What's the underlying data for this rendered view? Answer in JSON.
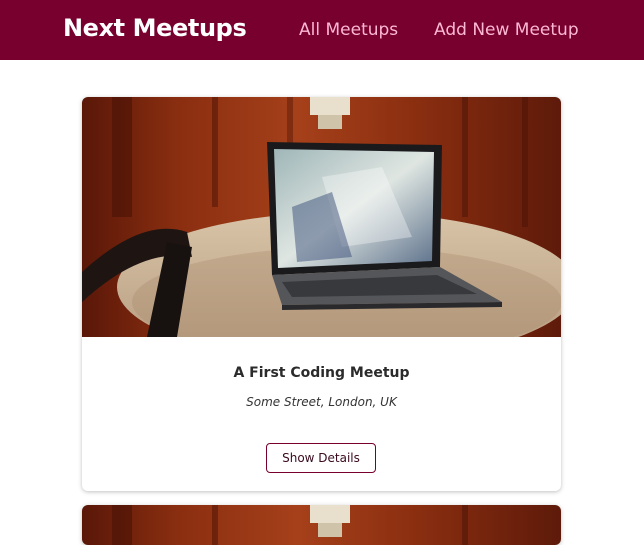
{
  "header": {
    "logo": "Next Meetups",
    "nav": [
      {
        "label": "All Meetups"
      },
      {
        "label": "Add New Meetup"
      }
    ]
  },
  "meetups": [
    {
      "title": "A First Coding Meetup",
      "address": "Some Street, London, UK",
      "button_label": "Show Details"
    }
  ],
  "colors": {
    "header_bg": "#77002e",
    "nav_link": "#fcb8d2",
    "button_border": "#77002e"
  }
}
